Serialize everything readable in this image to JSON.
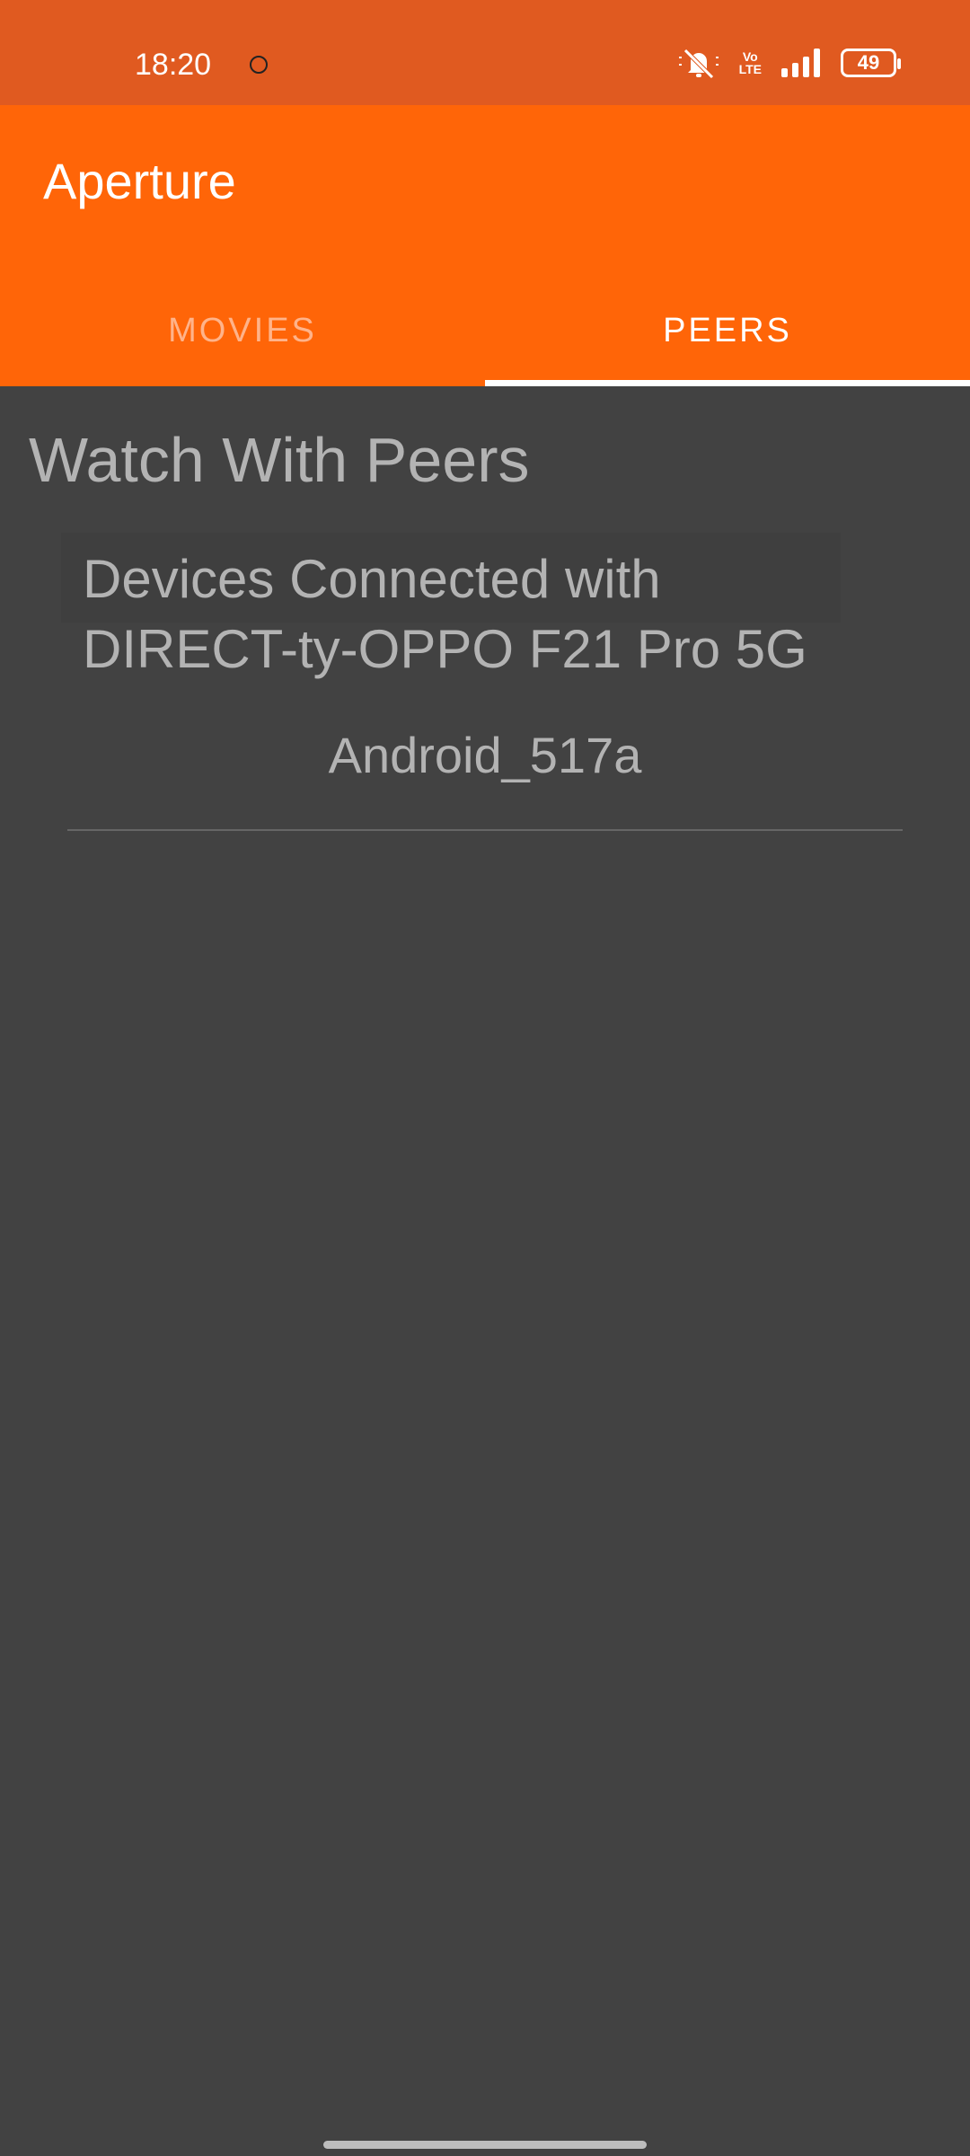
{
  "status_bar": {
    "time": "18:20",
    "network_label_top": "Vo",
    "network_label_bottom": "LTE",
    "battery": "49",
    "icons": [
      "sync-icon",
      "mute-icon",
      "volte-icon",
      "signal-icon",
      "battery-icon"
    ]
  },
  "app": {
    "title": "Aperture",
    "accent_color": "#ff6508"
  },
  "tabs": [
    {
      "label": "MOVIES",
      "selected": false
    },
    {
      "label": "PEERS",
      "selected": true
    }
  ],
  "peers": {
    "title": "Watch With Peers",
    "connected_header": "Devices Connected with DIRECT-ty-OPPO F21 Pro 5G",
    "devices": [
      "Android_517a"
    ]
  }
}
